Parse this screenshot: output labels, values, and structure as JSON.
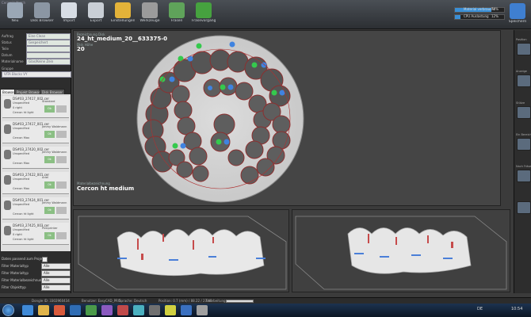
{
  "app": {
    "title": "Ceramill Match"
  },
  "toolbar": {
    "buttons": [
      {
        "label": "Neu",
        "icon": "new-file-icon",
        "color": "#9aa7b5"
      },
      {
        "label": "Disk Browser",
        "icon": "disk-browser-icon",
        "color": "#8b96a3"
      },
      {
        "label": "Import",
        "icon": "import-icon",
        "color": "#d7dde4"
      },
      {
        "label": "Export",
        "icon": "export-icon",
        "color": "#c9cfd6"
      },
      {
        "label": "Einstellungen",
        "icon": "settings-tools-icon",
        "color": "#e4b339"
      },
      {
        "label": "Werkzeuge",
        "icon": "tools-icon",
        "color": "#9b9b9b"
      },
      {
        "label": "Fräsen",
        "icon": "mill-icon",
        "color": "#5fa35a"
      },
      {
        "label": "Fräsevorgang",
        "icon": "play-icon",
        "color": "#46a23f"
      }
    ],
    "progress": [
      {
        "label": "Material verbraucht",
        "value": 0.74,
        "pct": "74%"
      },
      {
        "label": "CPU Auslastung",
        "value": 0.12,
        "pct": "12%"
      }
    ],
    "save_label": "Speichern"
  },
  "left_panel": {
    "fields": [
      {
        "label": "Auftrag",
        "value": "Eine Clean"
      },
      {
        "label": "Status",
        "value": "Gespeichert"
      },
      {
        "label": "Teile",
        "value": ""
      },
      {
        "label": "Datum",
        "value": ""
      },
      {
        "label": "Materialname",
        "value": "Glas/Keine Zein"
      }
    ],
    "gruppe_label": "Gruppe",
    "gruppe_value": "VITA Blocks VY",
    "tabs": [
      "Browser",
      "Projekt Browser",
      "Disk Browser"
    ],
    "cases": [
      {
        "id": "DS#03_27417_002.cer",
        "status": "Unspecified",
        "weight": "0 right",
        "material": "Cercon ht light",
        "name": "Standard",
        "badge": "Ok"
      },
      {
        "id": "DS#03_27417_001.cer",
        "status": "Unspecified",
        "weight": "",
        "material": "Cercon Max",
        "name": "Jimmy Waldmann",
        "badge": "0k"
      },
      {
        "id": "DS#03_27420_002.cer",
        "status": "Unspecified",
        "weight": "",
        "material": "Cercon Max",
        "name": "Jimmy Waldmann",
        "badge": "0k"
      },
      {
        "id": "DS#03_27422_001.cer",
        "status": "Unspecified",
        "weight": "",
        "material": "Cercon Max",
        "name": "Ariel",
        "badge": "0k"
      },
      {
        "id": "DS#03_27424_001.cer",
        "status": "Unspecified",
        "weight": "",
        "material": "Cercon ht light",
        "name": "Jimmy Waldmann",
        "badge": "0k"
      },
      {
        "id": "DS#03_27425_003.cer",
        "status": "Unspecified",
        "weight": "0 right",
        "material": "Cercon ht light",
        "name": "Pinkprinter",
        "badge": "0k"
      }
    ],
    "options": [
      {
        "label": "Daten passend zum Projekt",
        "type": "check",
        "value": ""
      },
      {
        "label": "Filter Materialtyp",
        "type": "select",
        "value": "Alle"
      },
      {
        "label": "Filter Materialtyp",
        "type": "select",
        "value": "Alle"
      },
      {
        "label": "Filter Materialbezeichnung",
        "type": "select",
        "value": "Alle"
      },
      {
        "label": "Filter Objekttyp",
        "type": "select",
        "value": "Alle"
      }
    ]
  },
  "main": {
    "blank_label": "Bezeichnung Disk",
    "blank_name": "24_ht_medium_20__633375-0",
    "height_label": "Disk Höhe",
    "height_value": "20",
    "material_label": "Materialbezeichnung",
    "material_value": "Cercon ht medium"
  },
  "right_panel": {
    "labels": [
      "Position",
      "Anzeige",
      "Stütze",
      "Ein Bereich",
      "Nach Fräsen"
    ],
    "button_icons": [
      "position-icon",
      "view-icon",
      "sprue-icon",
      "area-icon",
      "mill-after-icon",
      "settings-icon"
    ]
  },
  "status_bar": {
    "items": [
      "Dongle ID: 3302960434",
      "Benutzer: EasyCAD_PRO",
      "Sprache: Deutsch",
      "Position: 0.7 (mm) / 88.22 / 27.40",
      "Bearbeitung:"
    ]
  },
  "taskbar": {
    "apps": [
      "ie-icon",
      "explorer-icon",
      "media-icon",
      "app1-icon",
      "app2-icon",
      "app3-icon",
      "app4-icon",
      "app5-icon",
      "app6-icon",
      "app7-icon",
      "app8-icon",
      "app9-icon"
    ],
    "lang": "DE",
    "time": "10:54"
  }
}
